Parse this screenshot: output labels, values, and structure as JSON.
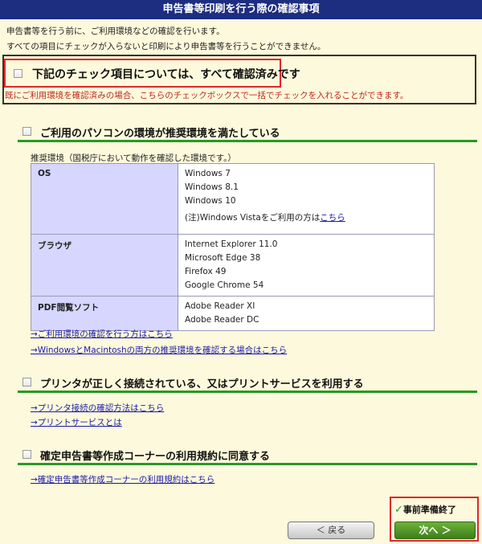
{
  "header": {
    "title": "申告書等印刷を行う際の確認事項"
  },
  "intro": [
    "申告書等を行う前に、ご利用環境などの確認を行います。",
    "すべての項目にチェックが入らないと印刷により申告書等を行うことができません。"
  ],
  "check_all": {
    "label": "下記のチェック項目については、すべて確認済みです",
    "note": "既にご利用環境を確認済みの場合、こちらのチェックボックスで一括でチェックを入れることができます。"
  },
  "section1": {
    "title": "ご利用のパソコンの環境が推奨環境を満たしている",
    "caption": "推奨環境（国税庁において動作を確認した環境です。）",
    "os": {
      "label": "OS",
      "values": [
        "Windows 7",
        "Windows 8.1",
        "Windows 10"
      ],
      "vista_note": "(注)Windows Vistaをご利用の方は",
      "vista_link": "こちら"
    },
    "browser": {
      "label": "ブラウザ",
      "values": [
        "Internet Explorer 11.0",
        "Microsoft Edge 38",
        "Firefox 49",
        "Google Chrome 54"
      ]
    },
    "pdf": {
      "label": "PDF閲覧ソフト",
      "values": [
        "Adobe Reader XI",
        "Adobe Reader DC"
      ]
    },
    "links": [
      "→ご利用環境の確認を行う方はこちら",
      "→WindowsとMacintoshの両方の推奨環境を確認する場合はこちら"
    ]
  },
  "section2": {
    "title": "プリンタが正しく接続されている、又はプリントサービスを利用する",
    "links": [
      "→プリンタ接続の確認方法はこちら",
      "→プリントサービスとは"
    ]
  },
  "section3": {
    "title": "確定申告書等作成コーナーの利用規約に同意する",
    "link": "→確定申告書等作成コーナーの利用規約はこちら"
  },
  "footer": {
    "back": "＜ 戻る",
    "done_check": "✓",
    "done_label": "事前準備終了",
    "next": "次へ ＞"
  }
}
